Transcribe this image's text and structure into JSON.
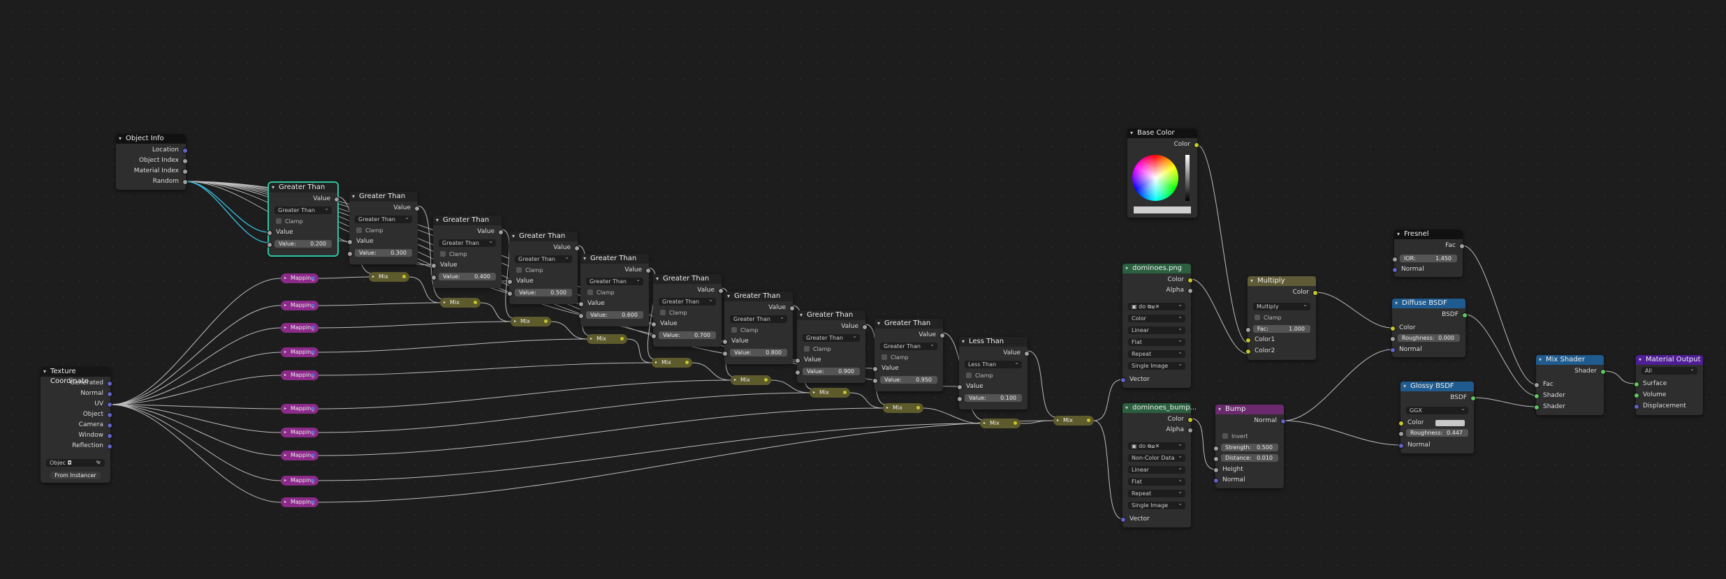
{
  "nodes": {
    "object_info": {
      "title": "Object Info",
      "outputs": [
        "Location",
        "Object Index",
        "Material Index",
        "Random"
      ]
    },
    "greater_than": [
      {
        "title": "Greater Than",
        "out": "Value",
        "op": "Greater Than",
        "clamp": "Clamp",
        "in": "Value",
        "field": "Value:",
        "val": "0.200"
      },
      {
        "title": "Greater Than",
        "out": "Value",
        "op": "Greater Than",
        "clamp": "Clamp",
        "in": "Value",
        "field": "Value:",
        "val": "0.300"
      },
      {
        "title": "Greater Than",
        "out": "Value",
        "op": "Greater Than",
        "clamp": "Clamp",
        "in": "Value",
        "field": "Value:",
        "val": "0.400"
      },
      {
        "title": "Greater Than",
        "out": "Value",
        "op": "Greater Than",
        "clamp": "Clamp",
        "in": "Value",
        "field": "Value:",
        "val": "0.500"
      },
      {
        "title": "Greater Than",
        "out": "Value",
        "op": "Greater Than",
        "clamp": "Clamp",
        "in": "Value",
        "field": "Value:",
        "val": "0.600"
      },
      {
        "title": "Greater Than",
        "out": "Value",
        "op": "Greater Than",
        "clamp": "Clamp",
        "in": "Value",
        "field": "Value:",
        "val": "0.700"
      },
      {
        "title": "Greater Than",
        "out": "Value",
        "op": "Greater Than",
        "clamp": "Clamp",
        "in": "Value",
        "field": "Value:",
        "val": "0.800"
      },
      {
        "title": "Greater Than",
        "out": "Value",
        "op": "Greater Than",
        "clamp": "Clamp",
        "in": "Value",
        "field": "Value:",
        "val": "0.900"
      },
      {
        "title": "Greater Than",
        "out": "Value",
        "op": "Greater Than",
        "clamp": "Clamp",
        "in": "Value",
        "field": "Value:",
        "val": "0.950"
      },
      {
        "title": "Less Than",
        "out": "Value",
        "op": "Less Than",
        "clamp": "Clamp",
        "in": "Value",
        "field": "Value:",
        "val": "0.100"
      }
    ],
    "texture_coordinate": {
      "title": "Texture Coordinate",
      "outputs": [
        "Generated",
        "Normal",
        "UV",
        "Object",
        "Camera",
        "Window",
        "Reflection"
      ],
      "object_field": "Objec",
      "from_instancer": "From Instancer"
    },
    "mapping_label": "Mapping",
    "mix_label": "Mix",
    "base_color": {
      "title": "Base Color",
      "out": "Color"
    },
    "tex1": {
      "title": "dominoes.png",
      "outputs": [
        "Color",
        "Alpha"
      ],
      "img": "do",
      "colorspace": "Color",
      "interp": "Linear",
      "proj": "Flat",
      "ext": "Repeat",
      "source": "Single Image",
      "in": "Vector"
    },
    "tex2": {
      "title": "dominoes_bump...",
      "outputs": [
        "Color",
        "Alpha"
      ],
      "img": "do",
      "colorspace": "Non-Color Data",
      "interp": "Linear",
      "proj": "Flat",
      "ext": "Repeat",
      "source": "Single Image",
      "in": "Vector"
    },
    "multiply": {
      "title": "Multiply",
      "out": "Color",
      "op": "Multiply",
      "clamp": "Clamp",
      "fac_label": "Fac:",
      "fac": "1.000",
      "in1": "Color1",
      "in2": "Color2"
    },
    "bump": {
      "title": "Bump",
      "out": "Normal",
      "invert": "Invert",
      "strength_label": "Strength:",
      "strength": "0.500",
      "distance_label": "Distance:",
      "distance": "0.010",
      "in_height": "Height",
      "in_normal": "Normal"
    },
    "fresnel": {
      "title": "Fresnel",
      "out": "Fac",
      "ior_label": "IOR:",
      "ior": "1.450",
      "in": "Normal"
    },
    "diffuse": {
      "title": "Diffuse BSDF",
      "out": "BSDF",
      "in_color": "Color",
      "rough_label": "Roughness:",
      "rough": "0.000",
      "in_normal": "Normal"
    },
    "glossy": {
      "title": "Glossy BSDF",
      "out": "BSDF",
      "dist": "GGX",
      "in_color": "Color",
      "rough_label": "Roughness:",
      "rough": "0.447",
      "in_normal": "Normal"
    },
    "mix_shader": {
      "title": "Mix Shader",
      "out": "Shader",
      "in_fac": "Fac",
      "in1": "Shader",
      "in2": "Shader"
    },
    "output": {
      "title": "Material Output",
      "target": "All",
      "in": [
        "Surface",
        "Volume",
        "Displacement"
      ]
    }
  },
  "colors": {
    "accent_selected": "#2ec4a0",
    "wire": "#bdbdbd",
    "wire_selected": "#3ab6d6",
    "mapping": "#8c2a8a",
    "mix": "#5d5a2c"
  }
}
